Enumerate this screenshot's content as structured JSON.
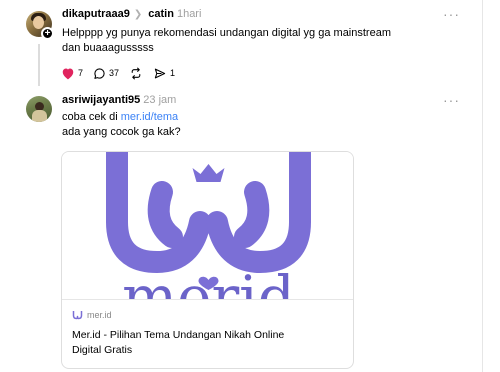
{
  "post1": {
    "username": "dikaputraaa9",
    "reply_to": "catin",
    "time": "1hari",
    "text_line1": "Helpppp yg punya rekomendasi undangan digital yg ga mainstream",
    "text_line2": "dan buaaagusssss",
    "likes": "7",
    "comments": "37",
    "shares": "1",
    "more_label": "···"
  },
  "post2": {
    "username": "asriwijayanti95",
    "time": "23 jam",
    "text_prefix": "coba cek di ",
    "link_text": "mer.id/tema",
    "text_line2": "ada yang cocok ga kak?",
    "more_label": "···"
  },
  "card": {
    "logo_text": "merid",
    "domain": "mer.id",
    "title": "Mer.id - Pilihan Tema Undangan Nikah Online Digital Gratis"
  },
  "colors": {
    "brand_purple": "#7b6fd6",
    "heart_red": "#e0245e",
    "link_blue": "#3b82f6"
  },
  "icons": [
    "heart-icon",
    "comment-icon",
    "repost-icon",
    "share-icon",
    "more-icon",
    "merid-logo-icon"
  ]
}
